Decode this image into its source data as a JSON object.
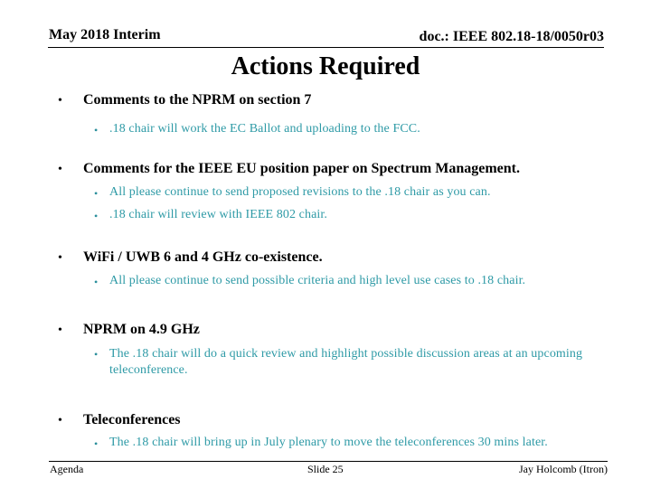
{
  "header": {
    "left": "May 2018 Interim",
    "right": "doc.: IEEE 802.18-18/0050r03"
  },
  "title": "Actions Required",
  "colors": {
    "body_text": "#000000",
    "sub_bullet_text": "#2e9aa6"
  },
  "bullets": [
    {
      "label": "Comments to the NPRM on section 7",
      "items": [
        ".18 chair will work the EC Ballot and uploading to the FCC."
      ]
    },
    {
      "label": "Comments for the IEEE EU position paper on Spectrum Management.",
      "items": [
        "All please continue to send proposed revisions to the .18 chair as you can.",
        ".18 chair will review with IEEE 802 chair."
      ]
    },
    {
      "label": "WiFi / UWB 6 and 4 GHz co-existence.",
      "items": [
        "All please continue to send possible criteria and high level use cases to .18 chair."
      ]
    },
    {
      "label": "NPRM on 4.9 GHz",
      "items": [
        "The .18 chair will do a quick review and highlight possible discussion areas at an upcoming teleconference."
      ]
    },
    {
      "label": "Teleconferences",
      "items": [
        "The .18 chair will bring up in July plenary to move the teleconferences 30 mins later."
      ]
    }
  ],
  "bullet_glyph": "•",
  "footer": {
    "left": "Agenda",
    "center": "Slide 25",
    "right": "Jay Holcomb (Itron)"
  }
}
